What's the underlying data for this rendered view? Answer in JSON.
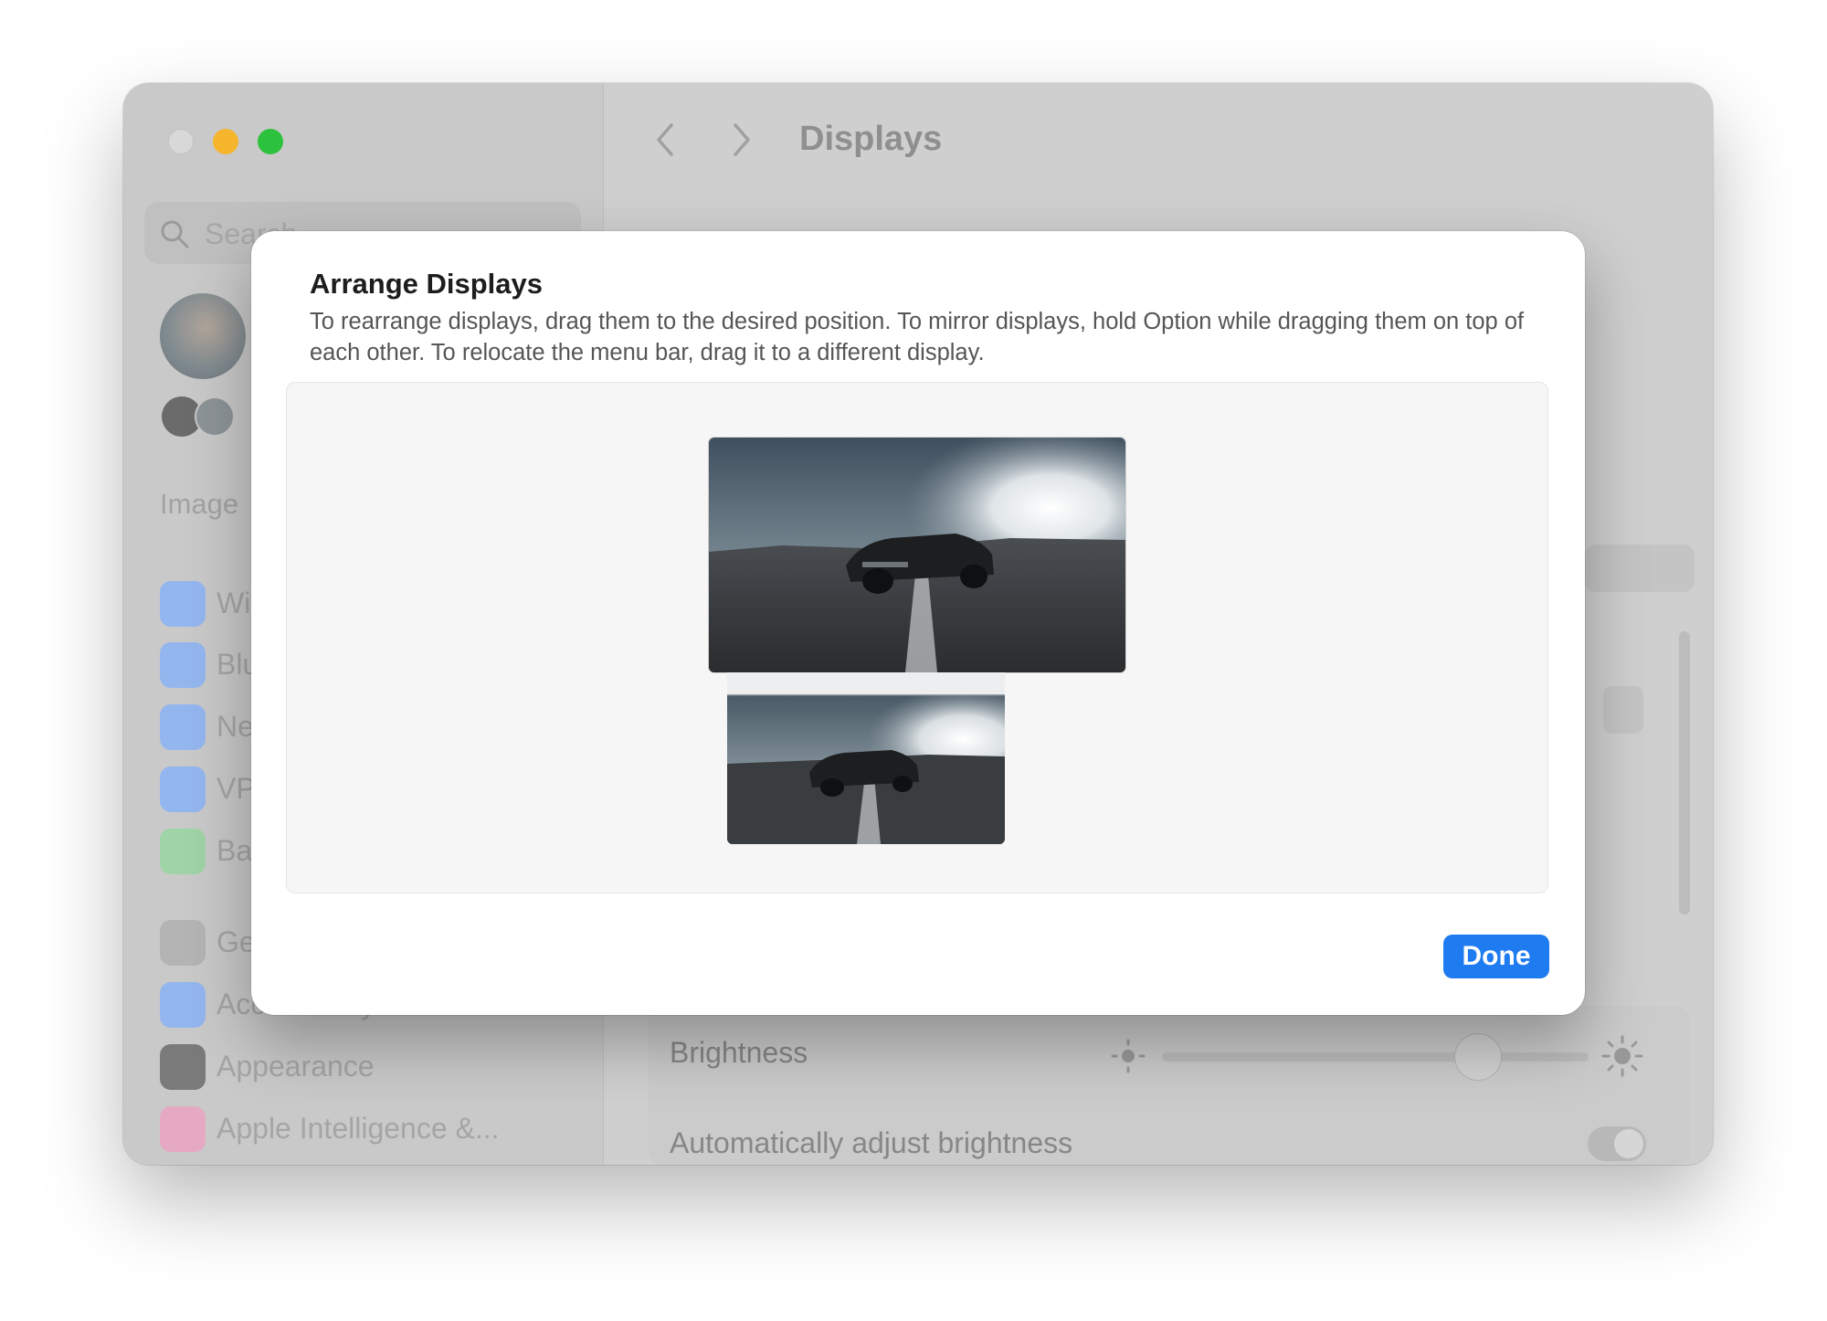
{
  "window": {
    "title": "Displays",
    "search_placeholder": "Search",
    "sidebar_section": "Image",
    "sidebar_items": [
      {
        "label": "Wi-Fi",
        "icon": "wifi-icon",
        "color": "#3b82f6"
      },
      {
        "label": "Bluetooth",
        "icon": "bluetooth-icon",
        "color": "#3b82f6"
      },
      {
        "label": "Network",
        "icon": "globe-icon",
        "color": "#3b82f6"
      },
      {
        "label": "VPN",
        "icon": "vpn-globe-icon",
        "color": "#3b82f6"
      },
      {
        "label": "Battery",
        "icon": "battery-icon",
        "color": "#34c759"
      },
      {
        "label": "General",
        "icon": "gear-icon",
        "color": "#8e8e93"
      },
      {
        "label": "Accessibility",
        "icon": "accessibility-icon",
        "color": "#3b82f6"
      },
      {
        "label": "Appearance",
        "icon": "appearance-icon",
        "color": "#1c1c1e"
      },
      {
        "label": "Apple Intelligence &...",
        "icon": "apple-intelligence-icon",
        "color": "#f472b6"
      }
    ],
    "brightness_label": "Brightness",
    "brightness_value": 0.73,
    "auto_brightness_label": "Automatically adjust brightness",
    "auto_brightness_on": true
  },
  "dialog": {
    "title": "Arrange Displays",
    "description": "To rearrange displays, drag them to the desired position. To mirror displays, hold Option while dragging them on top of each other. To relocate the menu bar, drag it to a different display.",
    "done_label": "Done",
    "accent": "#1f7bf0"
  }
}
